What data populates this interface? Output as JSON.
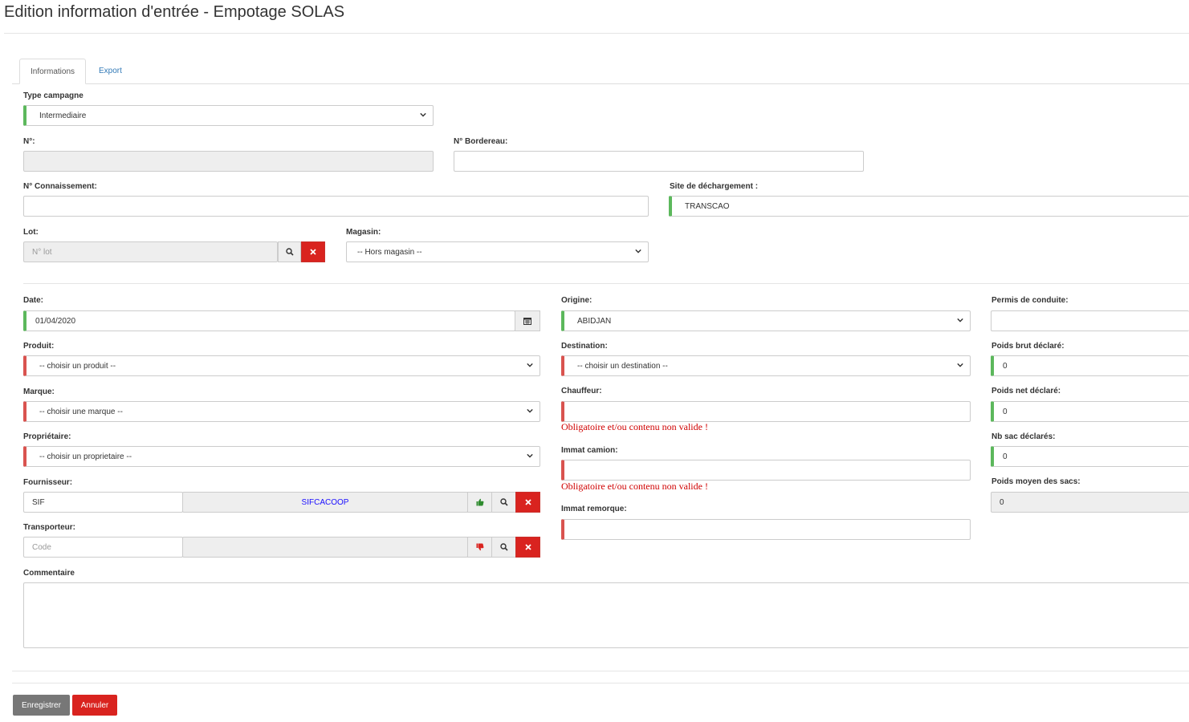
{
  "page": {
    "title": "Edition information d'entrée - Empotage SOLAS"
  },
  "tabs": [
    {
      "label": "Informations"
    },
    {
      "label": "Export"
    }
  ],
  "form": {
    "type_campagne": {
      "label": "Type campagne",
      "value": "Intermediaire"
    },
    "numero": {
      "label": "N°:",
      "value": ""
    },
    "bordereau": {
      "label": "N° Bordereau:",
      "value": ""
    },
    "connaissement": {
      "label": "N° Connaissement:",
      "value": ""
    },
    "site_dechargement": {
      "label": "Site de déchargement :",
      "value": "TRANSCAO"
    },
    "lot": {
      "label": "Lot:",
      "placeholder": "N° lot"
    },
    "magasin": {
      "label": "Magasin:",
      "value": "-- Hors magasin --"
    },
    "date": {
      "label": "Date:",
      "value": "01/04/2020"
    },
    "produit": {
      "label": "Produit:",
      "value": "-- choisir un produit --"
    },
    "marque": {
      "label": "Marque:",
      "value": "-- choisir une marque --"
    },
    "proprietaire": {
      "label": "Propriétaire:",
      "value": "-- choisir un proprietaire --"
    },
    "fournisseur": {
      "label": "Fournisseur:",
      "code": "SIF",
      "name": "SIFCACOOP"
    },
    "transporteur": {
      "label": "Transporteur:",
      "placeholder": "Code",
      "name": ""
    },
    "origine": {
      "label": "Origine:",
      "value": "ABIDJAN"
    },
    "destination": {
      "label": "Destination:",
      "value": "-- choisir un destination --"
    },
    "chauffeur": {
      "label": "Chauffeur:",
      "value": "",
      "error": "Obligatoire et/ou contenu non valide !"
    },
    "immat_camion": {
      "label": "Immat camion:",
      "value": "",
      "error": "Obligatoire et/ou contenu non valide !"
    },
    "immat_remorque": {
      "label": "Immat remorque:",
      "value": ""
    },
    "permis": {
      "label": "Permis de conduite:",
      "value": ""
    },
    "poids_brut": {
      "label": "Poids brut déclaré:",
      "value": "0"
    },
    "poids_net": {
      "label": "Poids net déclaré:",
      "value": "0"
    },
    "nb_sac": {
      "label": "Nb sac déclarés:",
      "value": "0"
    },
    "poids_moyen": {
      "label": "Poids moyen des sacs:",
      "value": "0"
    },
    "commentaire": {
      "label": "Commentaire",
      "value": ""
    }
  },
  "actions": {
    "save_label": "Enregistrer",
    "cancel_label": "Annuler"
  },
  "colors": {
    "valid": "#5cb85c",
    "invalid": "#d9534f",
    "danger": "#d9231f",
    "link": "#337ab7"
  }
}
